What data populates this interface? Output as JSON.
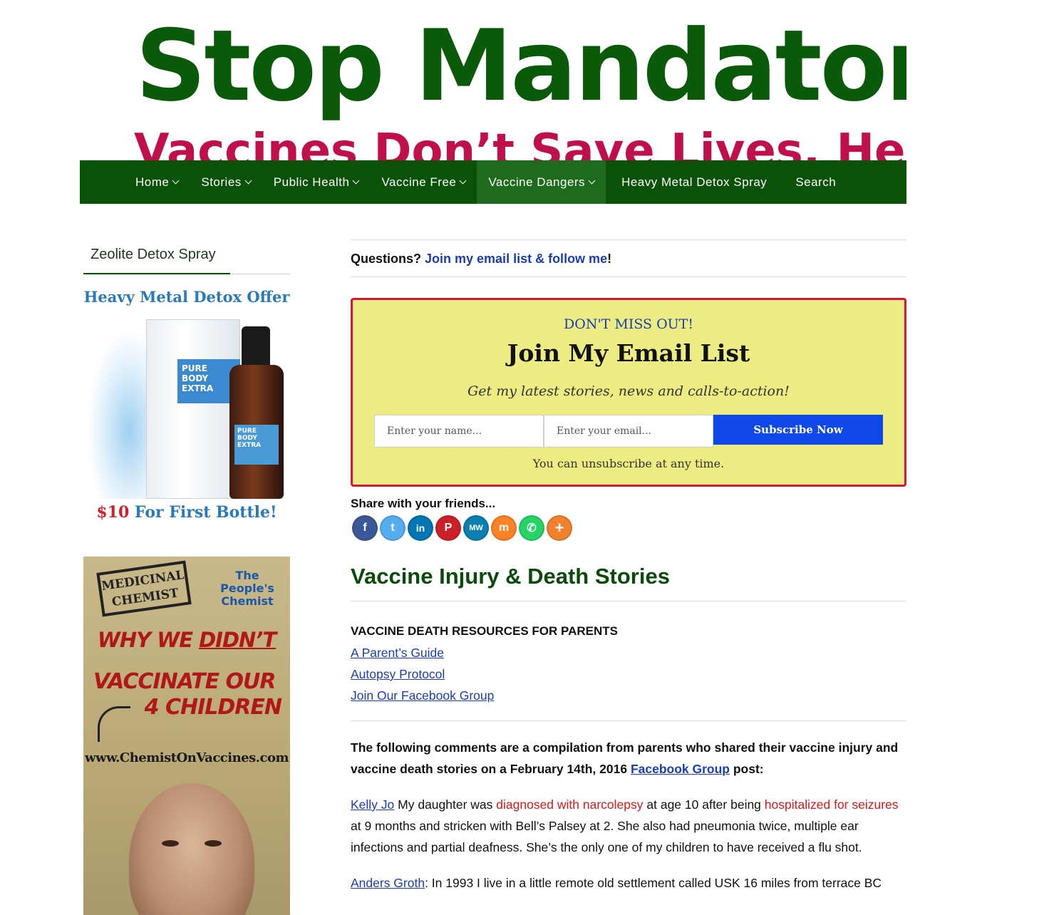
{
  "banner": {
    "title": "Stop Mandatory V",
    "subtitle": "Vaccines Don’t Save Lives. Healthy"
  },
  "nav": {
    "items": [
      {
        "label": "Home",
        "has_menu": true
      },
      {
        "label": "Stories",
        "has_menu": true
      },
      {
        "label": "Public Health",
        "has_menu": true
      },
      {
        "label": "Vaccine Free",
        "has_menu": true
      },
      {
        "label": "Vaccine Dangers",
        "has_menu": true,
        "active": true
      },
      {
        "label": "Heavy Metal Detox Spray",
        "has_menu": false
      },
      {
        "label": "Search",
        "has_menu": false
      }
    ]
  },
  "sidebar": {
    "widget_title": "Zeolite Detox Spray",
    "ad1": {
      "headline": "Heavy Metal Detox Offer",
      "product_box": "PURE BODY EXTRA",
      "product_bottle": "PURE BODY EXTRA",
      "offer_price": "$10",
      "offer_text": " For First Bottle!"
    },
    "ad2": {
      "stamp": "MEDICINAL CHEMIST",
      "brand": "The People's Chemist",
      "line1_pre": "WHY WE ",
      "line1_em": "DIDN’T",
      "line2a": "VACCINATE OUR",
      "line2b": "4 CHILDREN",
      "url": "www.ChemistOnVaccines.com"
    }
  },
  "main": {
    "questions_prefix": "Questions? ",
    "questions_link": "Join my email list & follow me",
    "questions_suffix": "!",
    "optin": {
      "pre_title": "DON'T MISS OUT!",
      "title": "Join My Email List",
      "subtitle": "Get my latest stories, news and calls-to-action!",
      "name_placeholder": "Enter your name...",
      "email_placeholder": "Enter your email...",
      "button": "Subscribe Now",
      "note": "You can unsubscribe at any time."
    },
    "share": {
      "label": "Share with your friends...",
      "buttons": [
        {
          "name": "facebook",
          "glyph": "f",
          "color": "#3b5998"
        },
        {
          "name": "twitter",
          "glyph": "t",
          "color": "#55acee"
        },
        {
          "name": "linkedin",
          "glyph": "in",
          "color": "#0077b5"
        },
        {
          "name": "pinterest",
          "glyph": "P",
          "color": "#cb2027"
        },
        {
          "name": "mewe",
          "glyph": "MW",
          "color": "#0a7fb0"
        },
        {
          "name": "mix",
          "glyph": "m",
          "color": "#ff8226"
        },
        {
          "name": "whatsapp",
          "glyph": "✆",
          "color": "#25d366"
        },
        {
          "name": "more",
          "glyph": "+",
          "color": "#f0822d"
        }
      ]
    },
    "post_title": "Vaccine Injury & Death Stories",
    "resources": {
      "heading": "VACCINE DEATH RESOURCES FOR PARENTS",
      "links": [
        "A Parent’s Guide",
        "Autopsy Protocol",
        "Join Our Facebook Group"
      ]
    },
    "intro": {
      "pre": "The following comments are a compilation from parents who shared their vaccine injury and vaccine death stories on a February 14th, 2016 ",
      "link": "Facebook Group",
      "post": " post:"
    },
    "story1": {
      "author": "Kelly Jo",
      "t1": " My daughter was ",
      "r1": "diagnosed with narcolepsy",
      "t2": " at age 10 after being ",
      "r2": "hospitalized for seizures",
      "t3": " at 9 months and stricken with Bell’s Palsey at 2. She also had pneumonia twice, multiple ear infections and partial deafness. She’s the only one of my children to have received a flu shot."
    },
    "story2": {
      "author": "Anders Groth",
      "text": ": In 1993 I live in a little remote old settlement called USK 16 miles from terrace BC"
    }
  }
}
